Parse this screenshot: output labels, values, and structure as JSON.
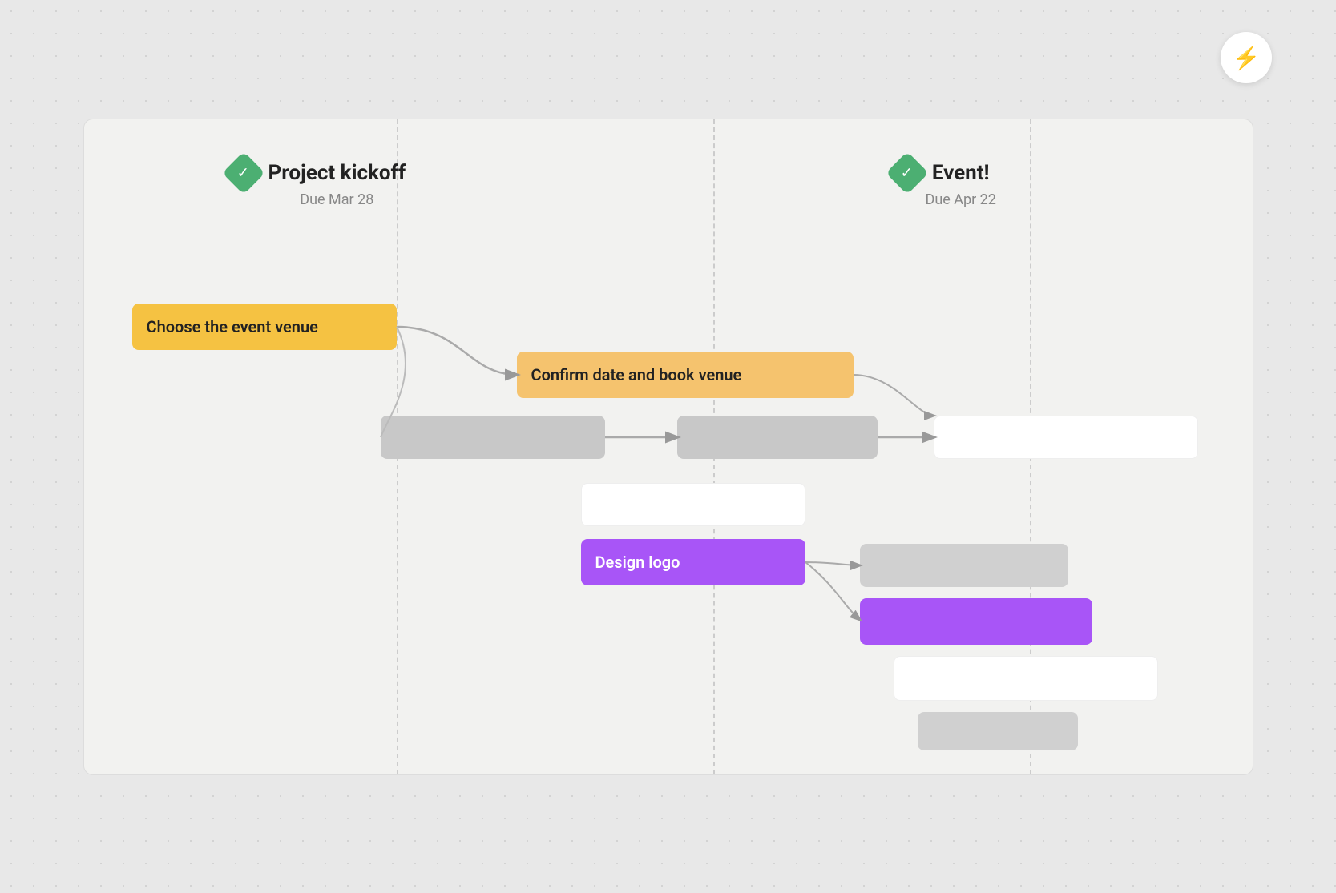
{
  "lightning": {
    "icon": "⚡"
  },
  "milestones": [
    {
      "id": "project-kickoff",
      "title": "Project kickoff",
      "due": "Due Mar 28",
      "check": "✓"
    },
    {
      "id": "event",
      "title": "Event!",
      "due": "Due Apr 22",
      "check": "✓"
    }
  ],
  "tasks": [
    {
      "id": "choose-venue",
      "label": "Choose the event venue",
      "color": "orange"
    },
    {
      "id": "confirm-date",
      "label": "Confirm date and book venue",
      "color": "orange"
    },
    {
      "id": "task-gray-1",
      "label": "",
      "color": "gray"
    },
    {
      "id": "task-gray-2",
      "label": "",
      "color": "gray"
    },
    {
      "id": "task-white-1",
      "label": "",
      "color": "white"
    },
    {
      "id": "task-white-2",
      "label": "",
      "color": "white"
    },
    {
      "id": "design-logo",
      "label": "Design logo",
      "color": "purple"
    },
    {
      "id": "task-gray-light-1",
      "label": "",
      "color": "gray-light"
    },
    {
      "id": "task-purple-2",
      "label": "",
      "color": "purple"
    },
    {
      "id": "task-white-3",
      "label": "",
      "color": "white"
    },
    {
      "id": "task-gray-light-2",
      "label": "",
      "color": "gray-light"
    }
  ]
}
